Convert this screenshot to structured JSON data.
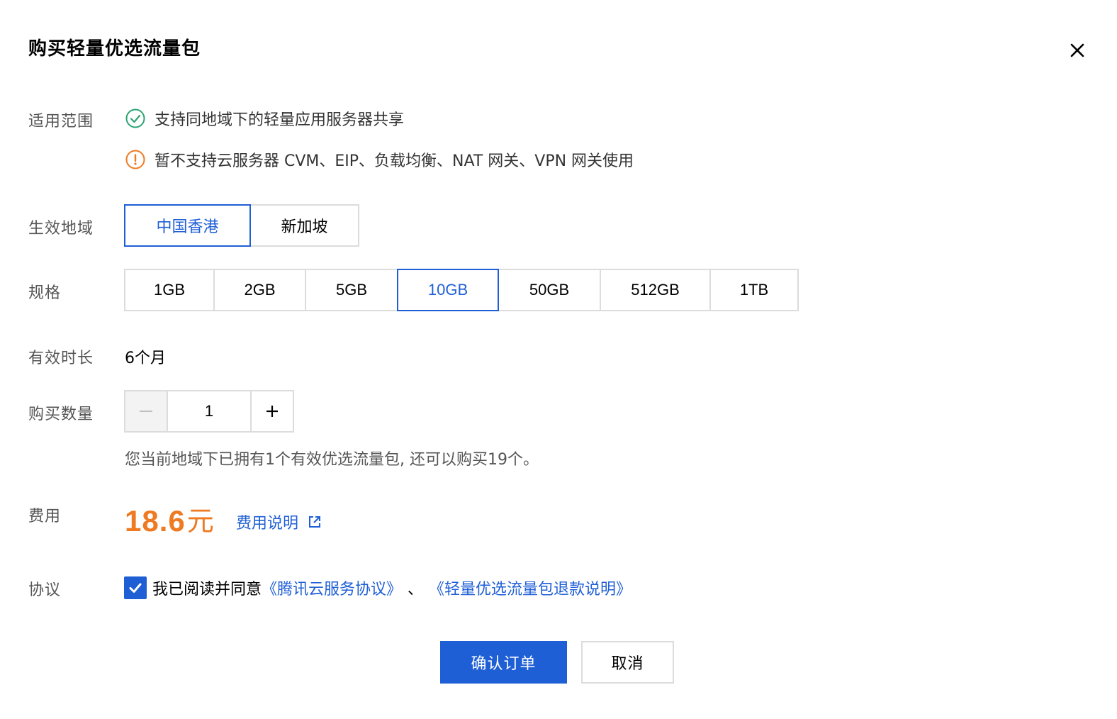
{
  "dialog": {
    "title": "购买轻量优选流量包"
  },
  "scope": {
    "label": "适用范围",
    "supported_text": "支持同地域下的轻量应用服务器共享",
    "unsupported_text": "暂不支持云服务器 CVM、EIP、负载均衡、NAT 网关、VPN 网关使用",
    "supported_color": "#2ba471",
    "unsupported_color": "#ee7a22"
  },
  "region": {
    "label": "生效地域",
    "options": [
      "中国香港",
      "新加坡"
    ],
    "selected": "中国香港"
  },
  "spec": {
    "label": "规格",
    "options": [
      "1GB",
      "2GB",
      "5GB",
      "10GB",
      "50GB",
      "512GB",
      "1TB"
    ],
    "selected": "10GB"
  },
  "duration": {
    "label": "有效时长",
    "value": "6个月"
  },
  "quantity": {
    "label": "购买数量",
    "value": "1",
    "minus": "−",
    "plus": "+",
    "hint": "您当前地域下已拥有1个有效优选流量包, 还可以购买19个。"
  },
  "fee": {
    "label": "费用",
    "amount": "18.6",
    "unit": "元",
    "link_text": "费用说明",
    "color": "#ee7a22"
  },
  "agreement": {
    "label": "协议",
    "checked": true,
    "prefix": "我已阅读并同意",
    "link1": "《腾讯云服务协议》",
    "separator": "、",
    "link2": "《轻量优选流量包退款说明》"
  },
  "actions": {
    "confirm": "确认订单",
    "cancel": "取消"
  },
  "theme": {
    "primary": "#1f5fd6",
    "border": "#dcdcdc"
  }
}
